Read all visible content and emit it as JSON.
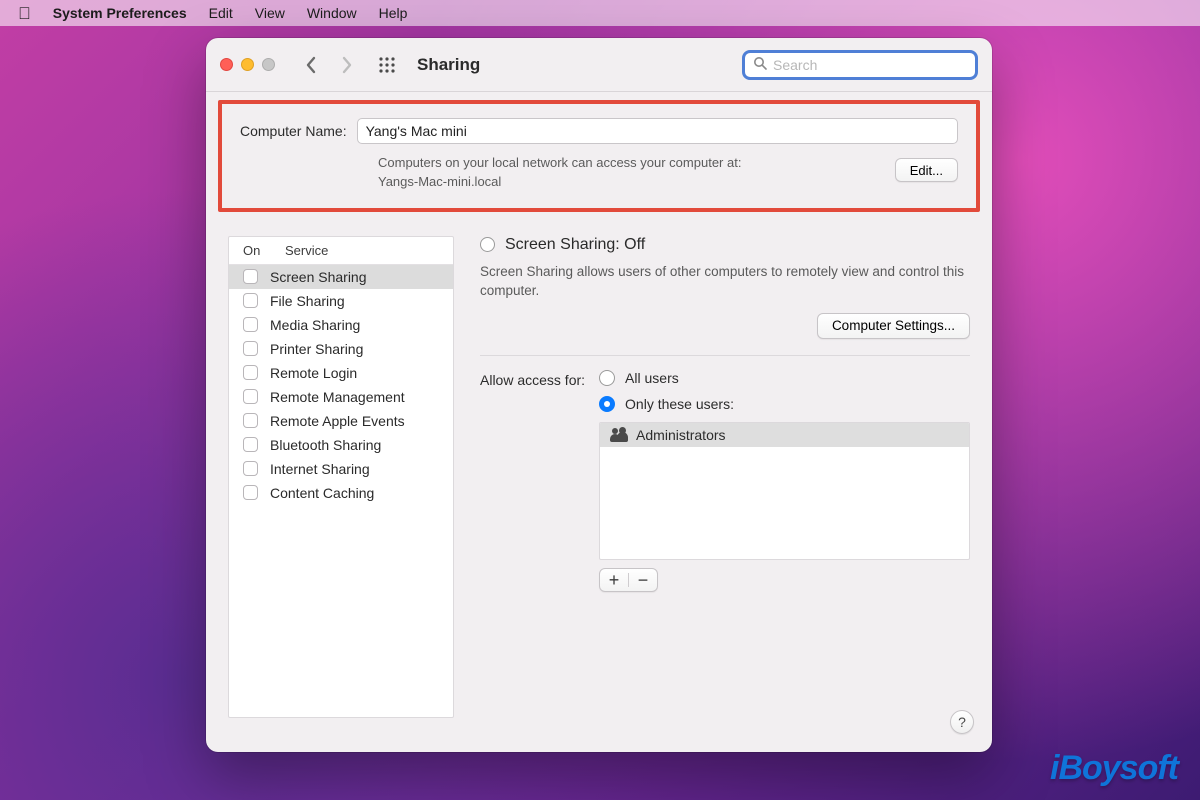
{
  "menubar": {
    "app_name": "System Preferences",
    "items": [
      "Edit",
      "View",
      "Window",
      "Help"
    ]
  },
  "window": {
    "title": "Sharing",
    "search_placeholder": "Search"
  },
  "computer_name": {
    "label": "Computer Name:",
    "value": "Yang's Mac mini",
    "hint_line1": "Computers on your local network can access your computer at:",
    "hint_line2": "Yangs-Mac-mini.local",
    "edit_label": "Edit..."
  },
  "services_header": {
    "on": "On",
    "service": "Service"
  },
  "services": [
    {
      "label": "Screen Sharing",
      "on": false,
      "selected": true
    },
    {
      "label": "File Sharing",
      "on": false
    },
    {
      "label": "Media Sharing",
      "on": false
    },
    {
      "label": "Printer Sharing",
      "on": false
    },
    {
      "label": "Remote Login",
      "on": false
    },
    {
      "label": "Remote Management",
      "on": false
    },
    {
      "label": "Remote Apple Events",
      "on": false
    },
    {
      "label": "Bluetooth Sharing",
      "on": false
    },
    {
      "label": "Internet Sharing",
      "on": false
    },
    {
      "label": "Content Caching",
      "on": false
    }
  ],
  "detail": {
    "heading": "Screen Sharing: Off",
    "description": "Screen Sharing allows users of other computers to remotely view and control this computer.",
    "computer_settings_label": "Computer Settings...",
    "access_label": "Allow access for:",
    "opt_all": "All users",
    "opt_only": "Only these users:",
    "selected_option": "only",
    "users": [
      "Administrators"
    ]
  },
  "help_label": "?",
  "watermark": "iBoysoft"
}
